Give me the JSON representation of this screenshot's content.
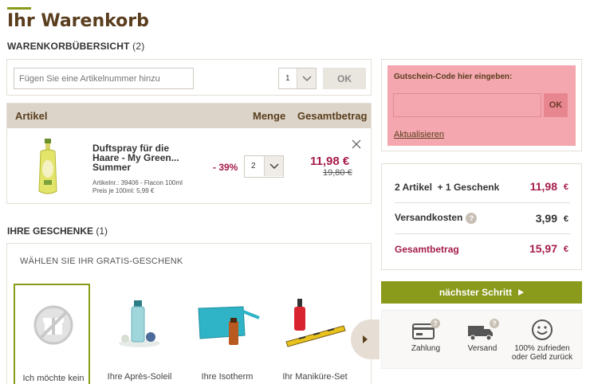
{
  "page": {
    "title": "Ihr Warenkorb",
    "overview_label": "WARENKORBÜBERSICHT",
    "overview_count": "(2)"
  },
  "add_article": {
    "placeholder": "Fügen Sie eine Artikelnummer hinzu",
    "quantity": "1",
    "ok_label": "OK"
  },
  "cart": {
    "columns": {
      "artikel": "Artikel",
      "menge": "Menge",
      "gesamtbetrag": "Gesamtbetrag"
    },
    "items": [
      {
        "name": "Duftspray für die Haare - My Green... Summer",
        "meta_line1": "Artikelnr.: 39406 - Flacon 100ml",
        "meta_line2": "Preis je 100ml: 5,99 €",
        "discount": "- 39%",
        "quantity": "2",
        "price_new": "11,98 €",
        "price_old": "19,80 €"
      }
    ]
  },
  "gifts": {
    "title": "IHRE GESCHENKE",
    "count": "(1)",
    "subtitle": "WÄHLEN SIE IHR GRATIS-GESCHENK",
    "items": [
      {
        "label": "Ich möchte kein Gratis-Geschenk"
      },
      {
        "label": "Ihre Après-Soleil Dusche"
      },
      {
        "label": "Ihre Isotherm Kosmetiktasche"
      },
      {
        "label": "Ihr Maniküre-Set GRATIS"
      }
    ]
  },
  "coupon": {
    "label": "Gutschein-Code hier eingeben:",
    "ok_label": "OK",
    "update_link": "Aktualisieren"
  },
  "summary": {
    "row1_label": "2 Artikel",
    "row1_extra": "+ 1 Geschenk",
    "row1_value": "11,98",
    "row2_label": "Versandkosten",
    "row2_value": "3,99",
    "row3_label": "Gesamtbetrag",
    "row3_value": "15,97",
    "currency": "€",
    "help_glyph": "?"
  },
  "next_step": {
    "label": "nächster Schritt"
  },
  "trust": [
    {
      "label": "Zahlung",
      "icon": "card-icon"
    },
    {
      "label": "Versand",
      "icon": "truck-icon"
    },
    {
      "label": "100% zufrieden oder Geld zurück",
      "icon": "smiley-icon"
    }
  ],
  "colors": {
    "accent_green": "#8a9a1b",
    "price_red": "#a51c4d",
    "brand_brown": "#5a3e1e",
    "coupon_pink": "#f4a7ae"
  }
}
